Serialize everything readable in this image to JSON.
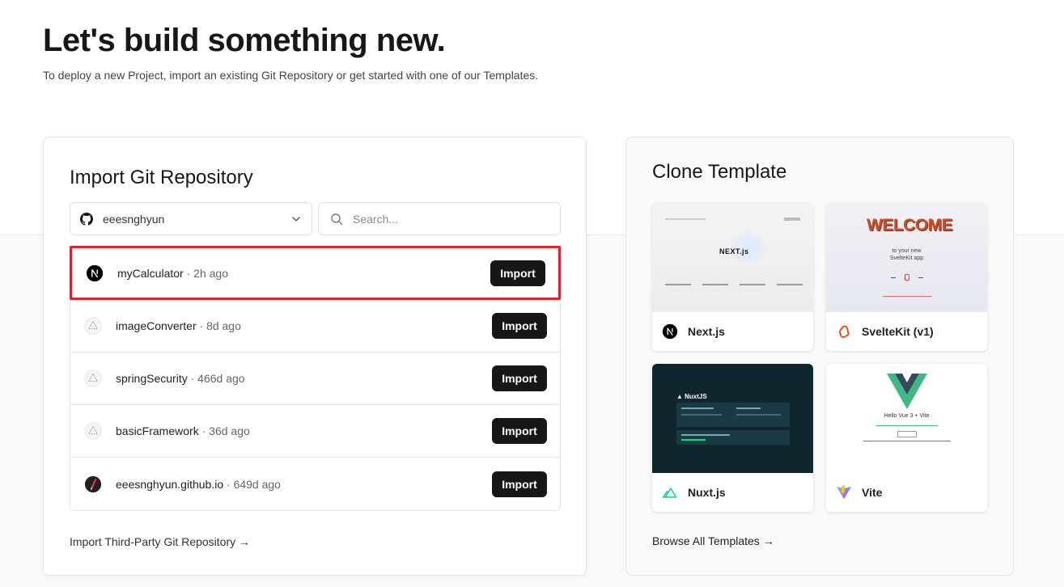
{
  "hero": {
    "title": "Let's build something new.",
    "subtitle": "To deploy a new Project, import an existing Git Repository or get started with one of our Templates."
  },
  "import_panel": {
    "title": "Import Git Repository",
    "owner": "eeesnghyun",
    "search_placeholder": "Search...",
    "repos": [
      {
        "name": "myCalculator",
        "ago": "2h ago",
        "icon": "nextjs-icon",
        "button": "Import"
      },
      {
        "name": "imageConverter",
        "ago": "8d ago",
        "icon": "vercel-triangle-icon",
        "button": "Import"
      },
      {
        "name": "springSecurity",
        "ago": "466d ago",
        "icon": "vercel-triangle-icon",
        "button": "Import"
      },
      {
        "name": "basicFramework",
        "ago": "36d ago",
        "icon": "vercel-triangle-icon",
        "button": "Import"
      },
      {
        "name": "eeesnghyun.github.io",
        "ago": "649d ago",
        "icon": "jekyll-icon",
        "button": "Import"
      }
    ],
    "third_party_link": "Import Third-Party Git Repository →"
  },
  "template_panel": {
    "title": "Clone Template",
    "templates": [
      {
        "label": "Next.js",
        "icon": "nextjs-icon"
      },
      {
        "label": "SvelteKit (v1)",
        "icon": "svelte-icon"
      },
      {
        "label": "Nuxt.js",
        "icon": "nuxt-icon"
      },
      {
        "label": "Vite",
        "icon": "vite-icon"
      }
    ],
    "browse_link": "Browse All Templates →",
    "thumbs": {
      "next_logo": "NEXT.js",
      "svelte_welcome": "WELCOME",
      "svelte_line1": "to your new",
      "svelte_line2": "SvelteKit app",
      "nuxt_brand": "NuxtJS",
      "vite_heading": "Hello Vue 3 + Vite"
    }
  },
  "colors": {
    "button_bg": "#171717",
    "highlight_border": "#e0202a",
    "nuxt_green": "#00dc82",
    "svelte_orange": "#ff3e00"
  }
}
